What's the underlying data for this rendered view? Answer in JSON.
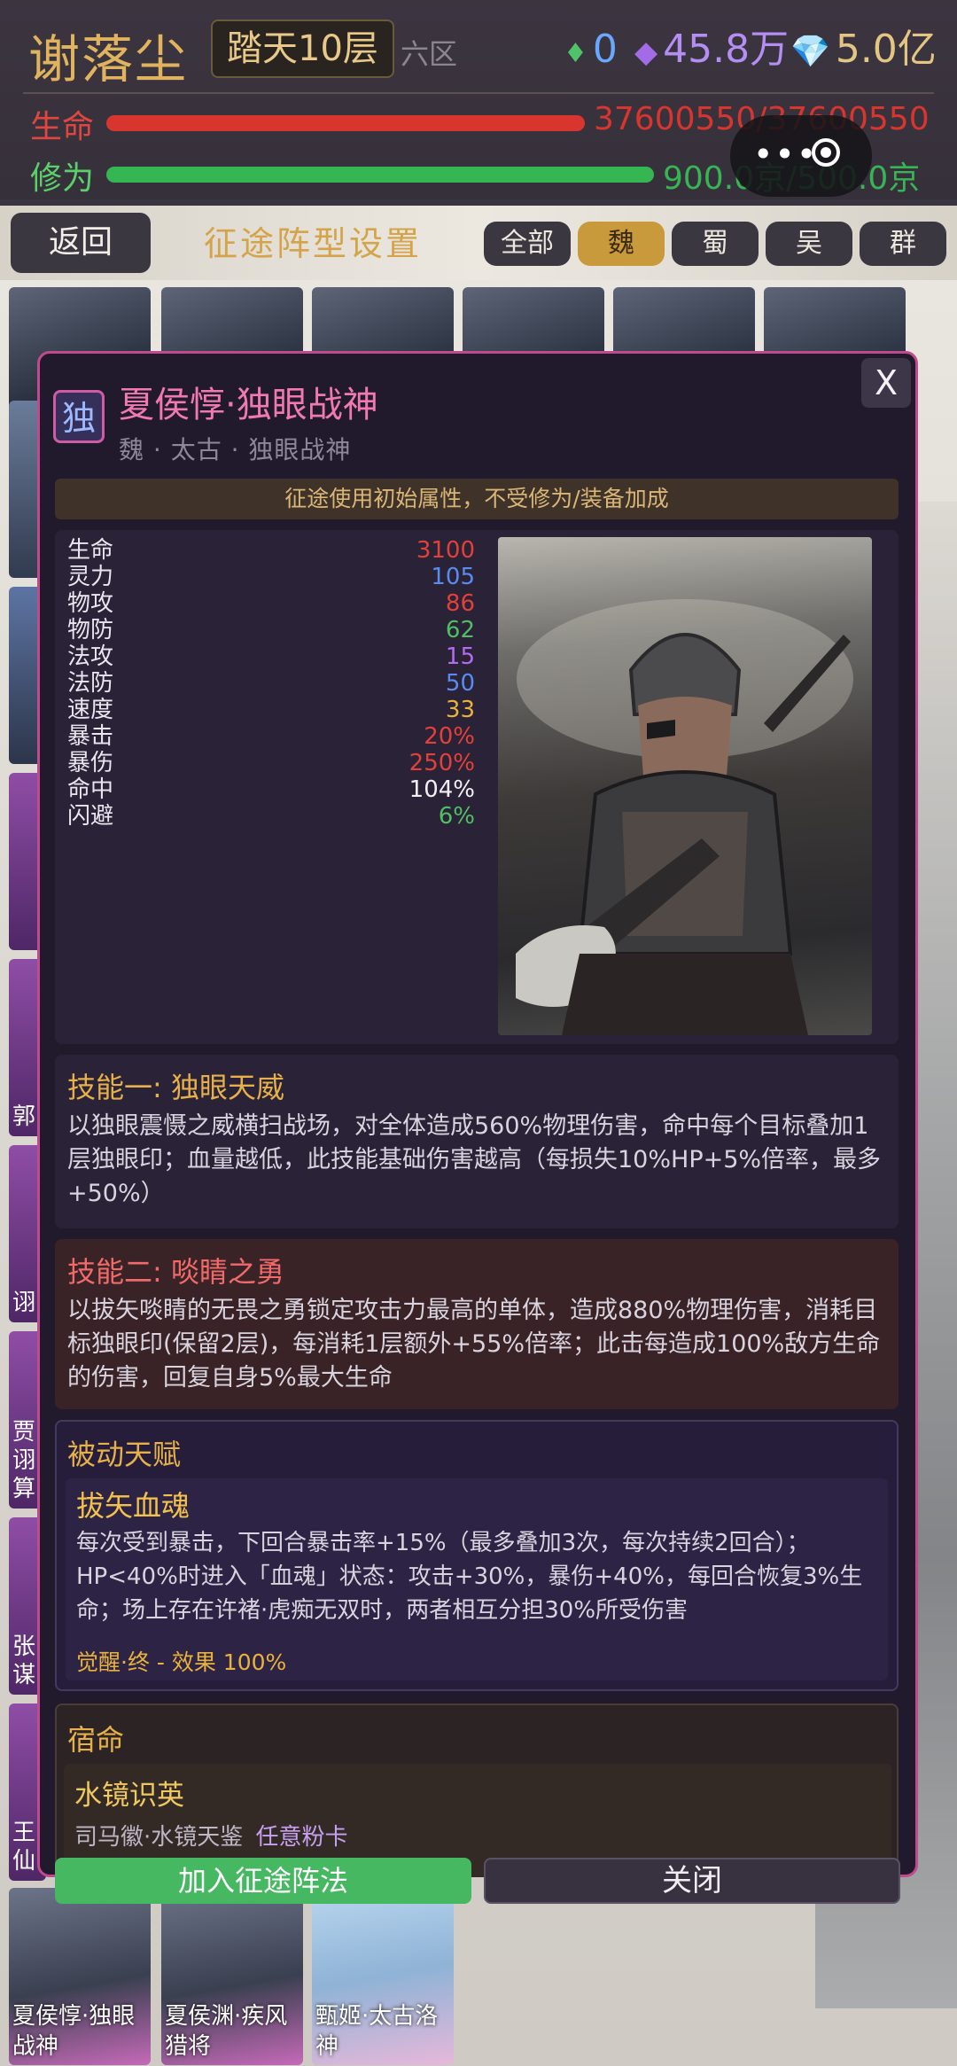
{
  "header": {
    "player_name": "谢落尘",
    "floor": "踏天10层",
    "zone": "六区",
    "currency": {
      "jade": "0",
      "spirit": "45.8万",
      "diamond": "5.0亿"
    },
    "hp": {
      "label": "生命",
      "value": "37600550/37600550"
    },
    "cultivation": {
      "label": "修为",
      "value": "900.0京/500.0京"
    },
    "mini_program_dots": "•••"
  },
  "nav": {
    "back_label": "返回",
    "title": "征途阵型设置",
    "tabs": [
      "全部",
      "魏",
      "蜀",
      "吴",
      "群"
    ],
    "active_tab": "魏"
  },
  "background": {
    "side_cards": [
      "贾诩\n算",
      "张\n谋",
      "王\n仙"
    ],
    "side_partial_labels": [
      "郭",
      "诩"
    ],
    "bottom_cards": [
      "夏侯惇·独眼战神",
      "夏侯渊·疾风猎将",
      "甄姬·太古洛神"
    ]
  },
  "modal": {
    "close_x": "X",
    "seal": "独",
    "name": "夏侯惇·独眼战神",
    "subtitle": "魏 · 太古 · 独眼战神",
    "notice": "征途使用初始属性，不受修为/装备加成",
    "stats": [
      {
        "key": "生命",
        "value": "3100",
        "color": "#e2403a"
      },
      {
        "key": "灵力",
        "value": "105",
        "color": "#5a8bef"
      },
      {
        "key": "物攻",
        "value": "86",
        "color": "#e2403a"
      },
      {
        "key": "物防",
        "value": "62",
        "color": "#4fbf62"
      },
      {
        "key": "法攻",
        "value": "15",
        "color": "#b36bf0"
      },
      {
        "key": "法防",
        "value": "50",
        "color": "#5a8bef"
      },
      {
        "key": "速度",
        "value": "33",
        "color": "#e8b23c"
      },
      {
        "key": "暴击",
        "value": "20%",
        "color": "#e2403a"
      },
      {
        "key": "暴伤",
        "value": "250%",
        "color": "#e2403a"
      },
      {
        "key": "命中",
        "value": "104%",
        "color": "#f1eef5"
      },
      {
        "key": "闪避",
        "value": "6%",
        "color": "#4fbf62"
      }
    ],
    "skill1": {
      "title": "技能一: 独眼天威",
      "body": "以独眼震慑之威横扫战场，对全体造成560%物理伤害，命中每个目标叠加1层独眼印；血量越低，此技能基础伤害越高（每损失10%HP+5%倍率，最多+50%）"
    },
    "skill2": {
      "title": "技能二: 啖睛之勇",
      "body": "以拔矢啖睛的无畏之勇锁定攻击力最高的单体，造成880%物理伤害，消耗目标独眼印(保留2层)，每消耗1层额外+55%倍率；此击每造成100%敌方生命的伤害，回复自身5%最大生命"
    },
    "passive": {
      "section_title": "被动天赋",
      "name": "拔矢血魂",
      "body": "每次受到暴击，下回合暴击率+15%（最多叠加3次，每次持续2回合）；HP<40%时进入「血魂」状态：攻击+30%，暴伤+40%，每回合恢复3%生命；场上存在许褚·虎痴无双时，两者相互分担30%所受伤害",
      "awaken": "觉醒·终 - 效果 100%"
    },
    "fate": {
      "section_title": "宿命",
      "name": "水镜识英",
      "req_heroes": "司马徽·水镜天鉴",
      "req_card": "任意粉卡"
    },
    "buttons": {
      "join": "加入征途阵法",
      "close": "关闭"
    }
  }
}
